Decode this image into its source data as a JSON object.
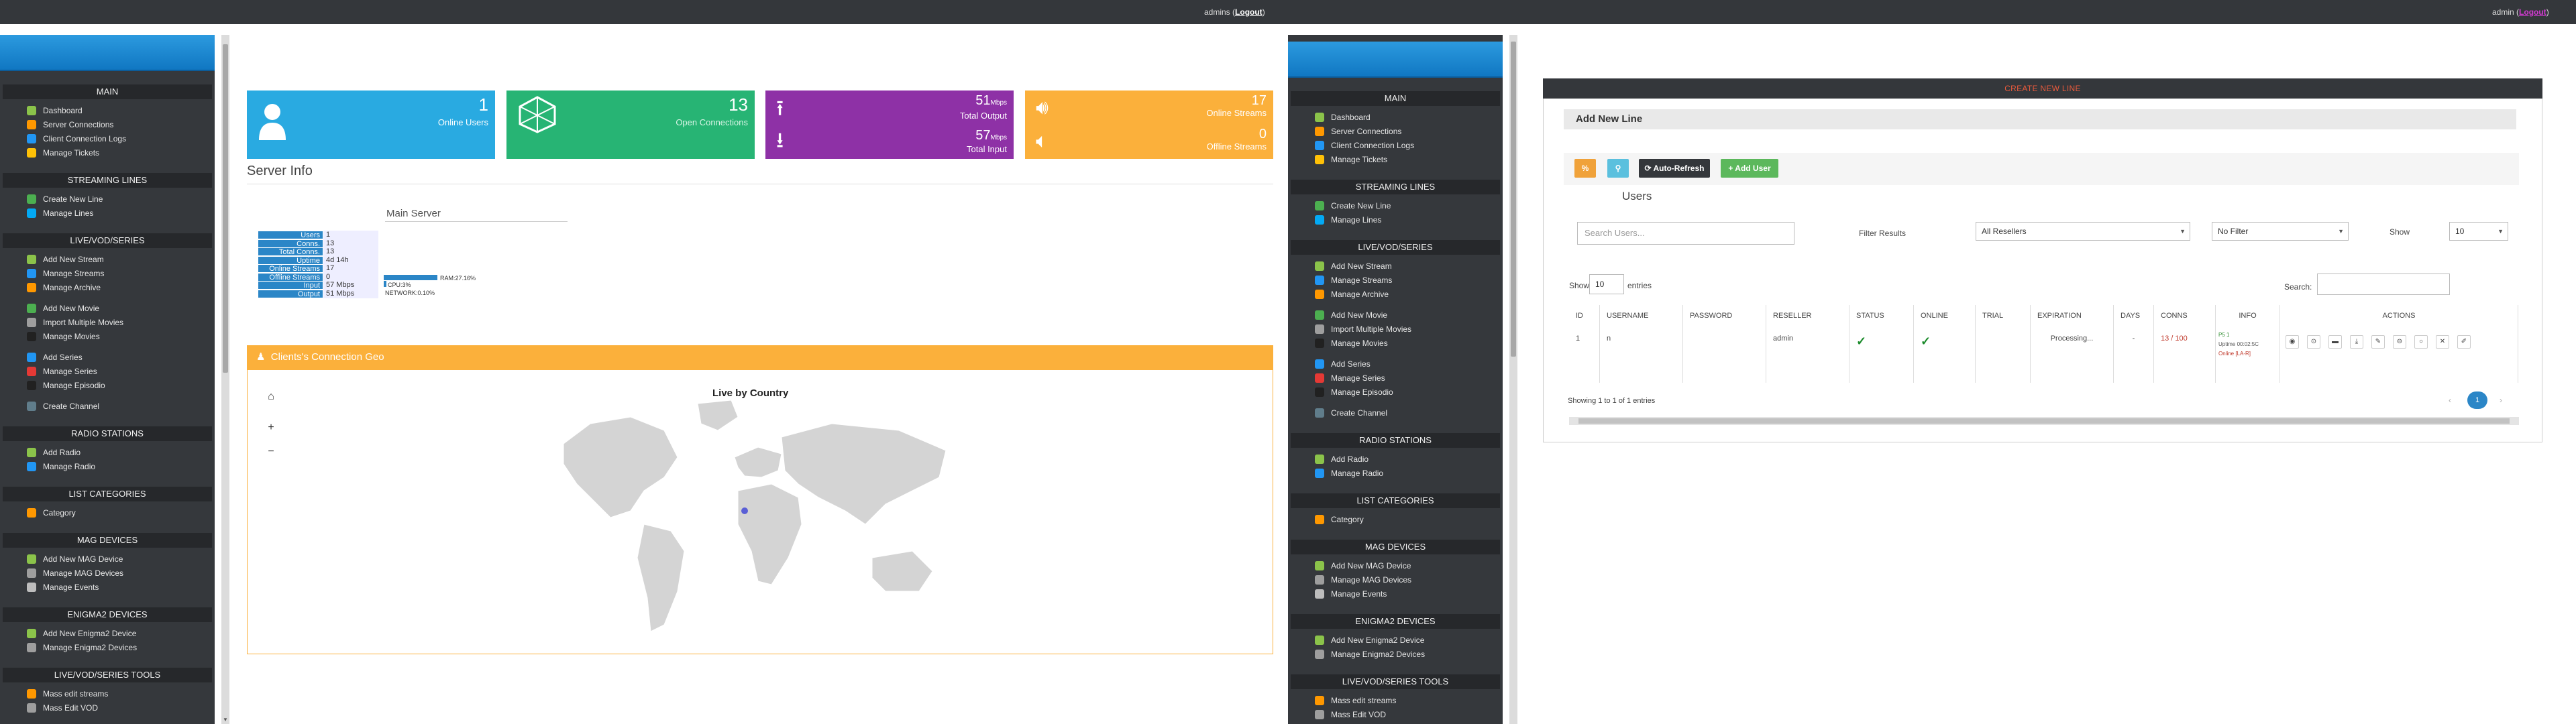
{
  "left": {
    "topbar": {
      "user": "admins",
      "logout": "Logout"
    },
    "sidebar": [
      {
        "section": "MAIN",
        "items": [
          {
            "label": "Dashboard",
            "icon": "dashboard-icon",
            "color": "#8bc34a"
          },
          {
            "label": "Server Connections",
            "icon": "connections-icon",
            "color": "#ff9800"
          },
          {
            "label": "Client Connection Logs",
            "icon": "logs-icon",
            "color": "#2196f3"
          },
          {
            "label": "Manage Tickets",
            "icon": "ticket-icon",
            "color": "#ffc107"
          }
        ]
      },
      {
        "section": "STREAMING LINES",
        "items": [
          {
            "label": "Create New Line",
            "icon": "add-line-icon",
            "color": "#4caf50"
          },
          {
            "label": "Manage Lines",
            "icon": "lines-icon",
            "color": "#03a9f4"
          }
        ]
      },
      {
        "section": "LIVE/VOD/SERIES",
        "items": [
          {
            "label": "Add New Stream",
            "icon": "add-stream-icon",
            "color": "#8bc34a"
          },
          {
            "label": "Manage Streams",
            "icon": "streams-icon",
            "color": "#2196f3"
          },
          {
            "label": "Manage Archive",
            "icon": "archive-icon",
            "color": "#ff9800"
          },
          {
            "label": "",
            "icon": "",
            "color": ""
          },
          {
            "label": "Add New Movie",
            "icon": "add-movie-icon",
            "color": "#4caf50"
          },
          {
            "label": "Import Multiple Movies",
            "icon": "import-icon",
            "color": "#9e9e9e"
          },
          {
            "label": "Manage Movies",
            "icon": "movies-icon",
            "color": "#212121"
          },
          {
            "label": "",
            "icon": "",
            "color": ""
          },
          {
            "label": "Add Series",
            "icon": "add-series-icon",
            "color": "#2196f3"
          },
          {
            "label": "Manage Series",
            "icon": "series-icon",
            "color": "#e53935"
          },
          {
            "label": "Manage Episodio",
            "icon": "episode-icon",
            "color": "#212121"
          },
          {
            "label": "",
            "icon": "",
            "color": ""
          },
          {
            "label": "Create Channel",
            "icon": "channel-icon",
            "color": "#607d8b"
          }
        ]
      },
      {
        "section": "RADIO STATIONS",
        "items": [
          {
            "label": "Add Radio",
            "icon": "add-radio-icon",
            "color": "#8bc34a"
          },
          {
            "label": "Manage Radio",
            "icon": "radio-icon",
            "color": "#2196f3"
          }
        ]
      },
      {
        "section": "LIST CATEGORIES",
        "items": [
          {
            "label": "Category",
            "icon": "category-icon",
            "color": "#ff9800"
          }
        ]
      },
      {
        "section": "MAG DEVICES",
        "items": [
          {
            "label": "Add New MAG Device",
            "icon": "add-mag-icon",
            "color": "#8bc34a"
          },
          {
            "label": "Manage MAG Devices",
            "icon": "mag-icon",
            "color": "#9e9e9e"
          },
          {
            "label": "Manage Events",
            "icon": "events-icon",
            "color": "#bdbdbd"
          }
        ]
      },
      {
        "section": "ENIGMA2 DEVICES",
        "items": [
          {
            "label": "Add New Enigma2 Device",
            "icon": "add-enigma-icon",
            "color": "#8bc34a"
          },
          {
            "label": "Manage Enigma2 Devices",
            "icon": "enigma-icon",
            "color": "#9e9e9e"
          }
        ]
      },
      {
        "section": "LIVE/VOD/SERIES TOOLS",
        "items": [
          {
            "label": "Mass edit streams",
            "icon": "mass-edit-icon",
            "color": "#ff9800"
          },
          {
            "label": "Mass Edit VOD",
            "icon": "mass-vod-icon",
            "color": "#9e9e9e"
          }
        ]
      }
    ],
    "stats": [
      {
        "value": "1",
        "label": "Online Users",
        "color": "#29aae1",
        "icon": "user-icon"
      },
      {
        "value": "13",
        "label": "Open Connections",
        "color": "#27b474",
        "icon": "network-icon"
      },
      {
        "value": "51",
        "unit": "Mbps",
        "label": "Total Output",
        "value2": "57",
        "unit2": "Mbps",
        "label2": "Total Input",
        "color": "#8e31a6",
        "icon": "upload-icon",
        "icon2": "download-icon"
      },
      {
        "value": "17",
        "label": "Online Streams",
        "value2": "0",
        "label2": "Offline Streams",
        "color": "#fbb03b",
        "icon": "volume-icon",
        "icon2": "volume-off-icon"
      }
    ],
    "server_info": {
      "title": "Server Info",
      "main_server": "Main Server",
      "rows": [
        {
          "k": "Users",
          "v": "1"
        },
        {
          "k": "Conns.",
          "v": "13"
        },
        {
          "k": "Total Conns.",
          "v": "13"
        },
        {
          "k": "Uptime",
          "v": "4d 14h"
        },
        {
          "k": "Online Streams",
          "v": "17"
        },
        {
          "k": "Offline Streams",
          "v": "0"
        },
        {
          "k": "Input",
          "v": "57 Mbps"
        },
        {
          "k": "Output",
          "v": "51 Mbps"
        }
      ],
      "ram": "RAM:27.16%",
      "cpu": "CPU:3%",
      "network": "NETWORK:0.10%"
    },
    "geo": {
      "header": "Clients's Connection Geo",
      "map_title": "Live by Country"
    }
  },
  "right": {
    "topbar": {
      "user": "admin",
      "logout": "Logout"
    },
    "card_title": "CREATE NEW LINE",
    "sub_title": "Add New Line",
    "toolbar": {
      "auto_refresh": "Auto-Refresh",
      "add_user": "+ Add User"
    },
    "users_heading": "Users",
    "search_placeholder": "Search Users...",
    "filter_results": "Filter Results",
    "all_resellers": "All Resellers",
    "no_filter": "No Filter",
    "show": "Show",
    "show_value": "10",
    "entries_show": "Show",
    "entries_value": "10",
    "entries_label": "entries",
    "search_label": "Search:",
    "columns": [
      "ID",
      "USERNAME",
      "PASSWORD",
      "RESELLER",
      "STATUS",
      "ONLINE",
      "TRIAL",
      "EXPIRATION",
      "DAYS",
      "CONNS",
      "INFO",
      "ACTIONS"
    ],
    "row": {
      "id": "1",
      "username": "n",
      "password": "",
      "reseller": "admin",
      "status": "✓",
      "online": "✓",
      "trial": "",
      "expiration": "Processing...",
      "days": "-",
      "conns": "13 / 100",
      "info1": "P5 1",
      "info2": "Uptime 00:02:5C",
      "info3": "Online [LA-R]"
    },
    "footer": "Showing 1 to 1 of 1 entries",
    "page": "1"
  }
}
